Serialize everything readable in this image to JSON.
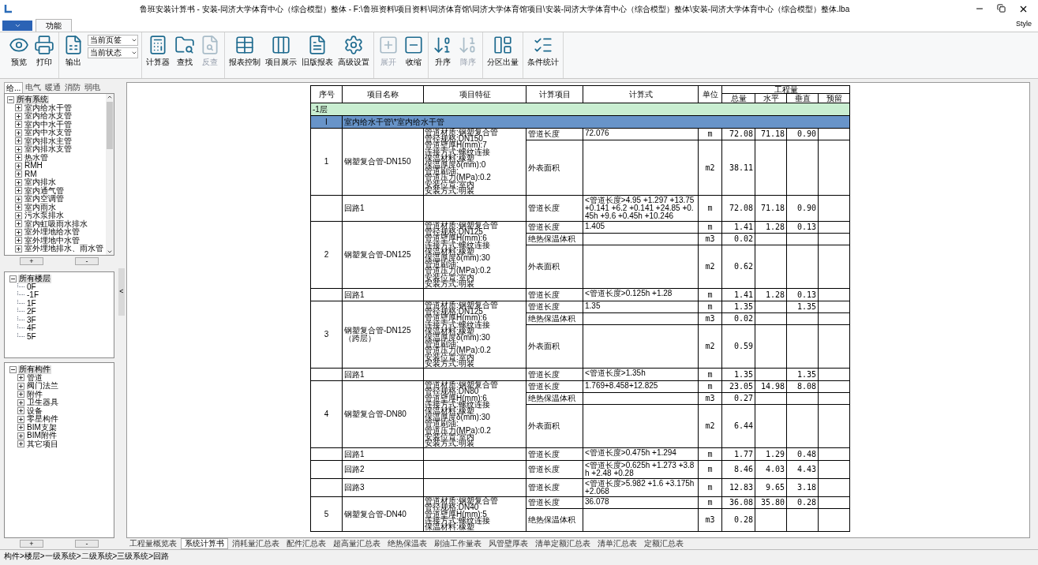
{
  "window": {
    "title": "鲁班安装计算书 - 安装-同济大学体育中心（综合模型）整体 - F:\\鲁班资料\\项目资料\\同济体育馆\\同济大学体育馆项目\\安装-同济大学体育中心（综合模型）整体\\安装-同济大学体育中心（综合模型）整体.lba"
  },
  "ribbon": {
    "tabs": [
      {
        "label": "功能",
        "selected": true
      }
    ],
    "style_menu": "Style",
    "groups": [
      {
        "buttons": [
          {
            "label": "预览",
            "disabled": false
          },
          {
            "label": "打印",
            "disabled": false
          }
        ]
      },
      {
        "buttons": [
          {
            "label": "输出",
            "disabled": false
          }
        ],
        "dropdowns": [
          {
            "value": "当前页签"
          },
          {
            "value": "当前状态"
          }
        ]
      },
      {
        "buttons": [
          {
            "label": "计算器",
            "disabled": false
          },
          {
            "label": "查找",
            "disabled": false
          },
          {
            "label": "反查",
            "disabled": true
          }
        ]
      },
      {
        "buttons": [
          {
            "label": "报表控制",
            "disabled": false
          },
          {
            "label": "项目展示",
            "disabled": false
          },
          {
            "label": "旧版报表",
            "disabled": false
          },
          {
            "label": "高级设置",
            "disabled": false
          }
        ]
      },
      {
        "buttons": [
          {
            "label": "展开",
            "disabled": true
          },
          {
            "label": "收缩",
            "disabled": false
          }
        ]
      },
      {
        "buttons": [
          {
            "label": "升序",
            "disabled": false
          },
          {
            "label": "降序",
            "disabled": true
          }
        ]
      },
      {
        "buttons": [
          {
            "label": "分区出量",
            "disabled": false
          }
        ]
      },
      {
        "buttons": [
          {
            "label": "条件统计",
            "disabled": false
          }
        ]
      }
    ]
  },
  "sidebar": {
    "tabs": [
      {
        "label": "给...",
        "selected": true
      },
      {
        "label": "电气",
        "selected": false
      },
      {
        "label": "暖通",
        "selected": false
      },
      {
        "label": "消防",
        "selected": false
      },
      {
        "label": "弱电",
        "selected": false
      }
    ],
    "system_tree": {
      "label": "所有系统",
      "expanded": true,
      "selected": true,
      "children": [
        {
          "label": "室内给水干管",
          "expanded": false,
          "selected": false
        },
        {
          "label": "室内给水支管",
          "expanded": false,
          "selected": false
        },
        {
          "label": "室内中水干管",
          "expanded": false,
          "selected": false
        },
        {
          "label": "室内中水支管",
          "expanded": false,
          "selected": false
        },
        {
          "label": "室内排水主管",
          "expanded": false,
          "selected": false
        },
        {
          "label": "室内排水支管",
          "expanded": false,
          "selected": false
        },
        {
          "label": "热水管",
          "expanded": false,
          "selected": false
        },
        {
          "label": "RMH",
          "expanded": false,
          "selected": false
        },
        {
          "label": "RM",
          "expanded": false,
          "selected": false
        },
        {
          "label": "室内排水",
          "expanded": false,
          "selected": false
        },
        {
          "label": "室内通气管",
          "expanded": false,
          "selected": false
        },
        {
          "label": "室内空调管",
          "expanded": false,
          "selected": false
        },
        {
          "label": "室内雨水",
          "expanded": false,
          "selected": false
        },
        {
          "label": "污水泵排水",
          "expanded": false,
          "selected": false
        },
        {
          "label": "室内虹吸雨水排水",
          "expanded": false,
          "selected": false
        },
        {
          "label": "室外埋地给水管",
          "expanded": false,
          "selected": false
        },
        {
          "label": "室外埋地中水管",
          "expanded": false,
          "selected": false
        },
        {
          "label": "室外埋地排水、雨水管",
          "expanded": false,
          "selected": false
        }
      ]
    },
    "system_buttons": [
      "+",
      "-"
    ],
    "floor_tree": {
      "label": "所有楼层",
      "expanded": true,
      "selected": true,
      "children": [
        {
          "label": "0F",
          "selected": false
        },
        {
          "label": "-1F",
          "selected": false
        },
        {
          "label": "1F",
          "selected": false
        },
        {
          "label": "2F",
          "selected": false
        },
        {
          "label": "3F",
          "selected": false
        },
        {
          "label": "4F",
          "selected": false
        },
        {
          "label": "5F",
          "selected": false
        }
      ]
    },
    "component_tree": {
      "label": "所有构件",
      "expanded": true,
      "selected": true,
      "children": [
        {
          "label": "管道",
          "expanded": false,
          "selected": false
        },
        {
          "label": "阀门法兰",
          "expanded": false,
          "selected": false
        },
        {
          "label": "附件",
          "expanded": false,
          "selected": false
        },
        {
          "label": "卫生器具",
          "expanded": false,
          "selected": false
        },
        {
          "label": "设备",
          "expanded": false,
          "selected": false
        },
        {
          "label": "零星构件",
          "expanded": false,
          "selected": false
        },
        {
          "label": "BIM支架",
          "expanded": false,
          "selected": false
        },
        {
          "label": "BIM附件",
          "expanded": false,
          "selected": false
        },
        {
          "label": "其它项目",
          "expanded": false,
          "selected": false
        }
      ]
    },
    "component_buttons": [
      "+",
      "-"
    ],
    "splitter_toggle": "<"
  },
  "table": {
    "columns": [
      "序号",
      "项目名称",
      "项目特征",
      "计算项目",
      "计算式",
      "单位",
      "工程量"
    ],
    "sub_columns": [
      "总量",
      "水平",
      "垂直",
      "预留"
    ],
    "rows": [
      {
        "kind": "floor",
        "label": "-1层"
      },
      {
        "kind": "system",
        "number": "I",
        "label": "室内给水干管\\*室内给水干管"
      },
      {
        "kind": "item",
        "number": "1",
        "name": "钢塑复合管-DN150",
        "features": [
          "管道材质:钢塑复合管",
          "管径规格:DN150",
          "管道壁厚H(mm):7",
          "连接方式:螺纹连接",
          "保温材料:橡塑",
          "保温厚度δ(mm):0",
          "管道刷油:",
          "管道压力(MPa):0.2",
          "安装位置:室内",
          "安装方式:明装"
        ],
        "calcs": [
          {
            "item": "管道长度",
            "formula": "72.076",
            "unit": "m",
            "total": "72.08",
            "horizontal": "71.18",
            "vertical": "0.90"
          },
          {
            "item": "外表面积",
            "unit": "m2",
            "total": "38.11"
          }
        ]
      },
      {
        "kind": "loop",
        "name": "回路1",
        "calcs": [
          {
            "item": "管道长度",
            "formula": "<管道长度>4.95 +1.297 +13.75 +0.141 +6.2 +0.141 +24.85 +0.45h +9.6 +0.45h +10.246",
            "unit": "m",
            "total": "72.08",
            "horizontal": "71.18",
            "vertical": "0.90"
          }
        ]
      },
      {
        "kind": "item",
        "number": "2",
        "name": "钢塑复合管-DN125",
        "features": [
          "管道材质:钢塑复合管",
          "管径规格:DN125",
          "管道壁厚H(mm):6",
          "连接方式:螺纹连接",
          "保温材料:橡塑",
          "保温厚度δ(mm):30",
          "管道刷油:",
          "管道压力(MPa):0.2",
          "安装位置:室内",
          "安装方式:明装"
        ],
        "calcs": [
          {
            "item": "管道长度",
            "formula": "1.405",
            "unit": "m",
            "total": "1.41",
            "horizontal": "1.28",
            "vertical": "0.13"
          },
          {
            "item": "绝热保温体积",
            "unit": "m3",
            "total": "0.02"
          },
          {
            "item": "外表面积",
            "unit": "m2",
            "total": "0.62"
          }
        ]
      },
      {
        "kind": "loop",
        "name": "回路1",
        "calcs": [
          {
            "item": "管道长度",
            "formula": "<管道长度>0.125h +1.28",
            "unit": "m",
            "total": "1.41",
            "horizontal": "1.28",
            "vertical": "0.13"
          }
        ]
      },
      {
        "kind": "item",
        "number": "3",
        "name": "钢塑复合管-DN125（跨层）",
        "features": [
          "管道材质:钢塑复合管",
          "管径规格:DN125",
          "管道壁厚H(mm):6",
          "连接方式:螺纹连接",
          "保温材料:橡塑",
          "保温厚度δ(mm):30",
          "管道刷油:",
          "管道压力(MPa):0.2",
          "安装位置:室内",
          "安装方式:明装"
        ],
        "calcs": [
          {
            "item": "管道长度",
            "formula": "1.35",
            "unit": "m",
            "total": "1.35",
            "vertical": "1.35"
          },
          {
            "item": "绝热保温体积",
            "unit": "m3",
            "total": "0.02"
          },
          {
            "item": "外表面积",
            "unit": "m2",
            "total": "0.59"
          }
        ]
      },
      {
        "kind": "loop",
        "name": "回路1",
        "calcs": [
          {
            "item": "管道长度",
            "formula": "<管道长度>1.35h",
            "unit": "m",
            "total": "1.35",
            "vertical": "1.35"
          }
        ]
      },
      {
        "kind": "item",
        "number": "4",
        "name": "钢塑复合管-DN80",
        "features": [
          "管道材质:钢塑复合管",
          "管径规格:DN80",
          "管道壁厚H(mm):6",
          "连接方式:螺纹连接",
          "保温材料:橡塑",
          "保温厚度δ(mm):30",
          "管道刷油:",
          "管道压力(MPa):0.2",
          "安装位置:室内",
          "安装方式:明装"
        ],
        "calcs": [
          {
            "item": "管道长度",
            "formula": "1.769+8.458+12.825",
            "unit": "m",
            "total": "23.05",
            "horizontal": "14.98",
            "vertical": "8.08"
          },
          {
            "item": "绝热保温体积",
            "unit": "m3",
            "total": "0.27"
          },
          {
            "item": "外表面积",
            "unit": "m2",
            "total": "6.44"
          }
        ]
      },
      {
        "kind": "loop",
        "name": "回路1",
        "calcs": [
          {
            "item": "管道长度",
            "formula": "<管道长度>0.475h +1.294",
            "unit": "m",
            "total": "1.77",
            "horizontal": "1.29",
            "vertical": "0.48"
          }
        ]
      },
      {
        "kind": "loop",
        "name": "回路2",
        "calcs": [
          {
            "item": "管道长度",
            "formula": "<管道长度>0.625h +1.273 +3.8h +2.48 +0.28",
            "unit": "m",
            "total": "8.46",
            "horizontal": "4.03",
            "vertical": "4.43"
          }
        ]
      },
      {
        "kind": "loop",
        "name": "回路3",
        "calcs": [
          {
            "item": "管道长度",
            "formula": "<管道长度>5.982 +1.6 +3.175h +2.068",
            "unit": "m",
            "total": "12.83",
            "horizontal": "9.65",
            "vertical": "3.18"
          }
        ]
      },
      {
        "kind": "item",
        "number": "5",
        "name": "钢塑复合管-DN40",
        "features": [
          "管道材质:钢塑复合管",
          "管径规格:DN40",
          "管道壁厚H(mm):5",
          "连接方式:螺纹连接",
          "保温材料:橡塑"
        ],
        "calcs": [
          {
            "item": "管道长度",
            "formula": "36.078",
            "unit": "m",
            "total": "36.08",
            "horizontal": "35.80",
            "vertical": "0.28"
          },
          {
            "item": "绝热保温体积",
            "unit": "m3",
            "total": "0.28"
          }
        ]
      }
    ]
  },
  "report_tabs": [
    {
      "label": "工程量概览表",
      "selected": false
    },
    {
      "label": "系统计算书",
      "selected": true
    },
    {
      "label": "消耗量汇总表",
      "selected": false
    },
    {
      "label": "配件汇总表",
      "selected": false
    },
    {
      "label": "超高量汇总表",
      "selected": false
    },
    {
      "label": "绝热保温表",
      "selected": false
    },
    {
      "label": "刷油工作量表",
      "selected": false
    },
    {
      "label": "风管壁厚表",
      "selected": false
    },
    {
      "label": "清单定额汇总表",
      "selected": false
    },
    {
      "label": "清单汇总表",
      "selected": false
    },
    {
      "label": "定额汇总表",
      "selected": false
    }
  ],
  "status_bar": "构件>楼层>一级系统>二级系统>三级系统>回路"
}
